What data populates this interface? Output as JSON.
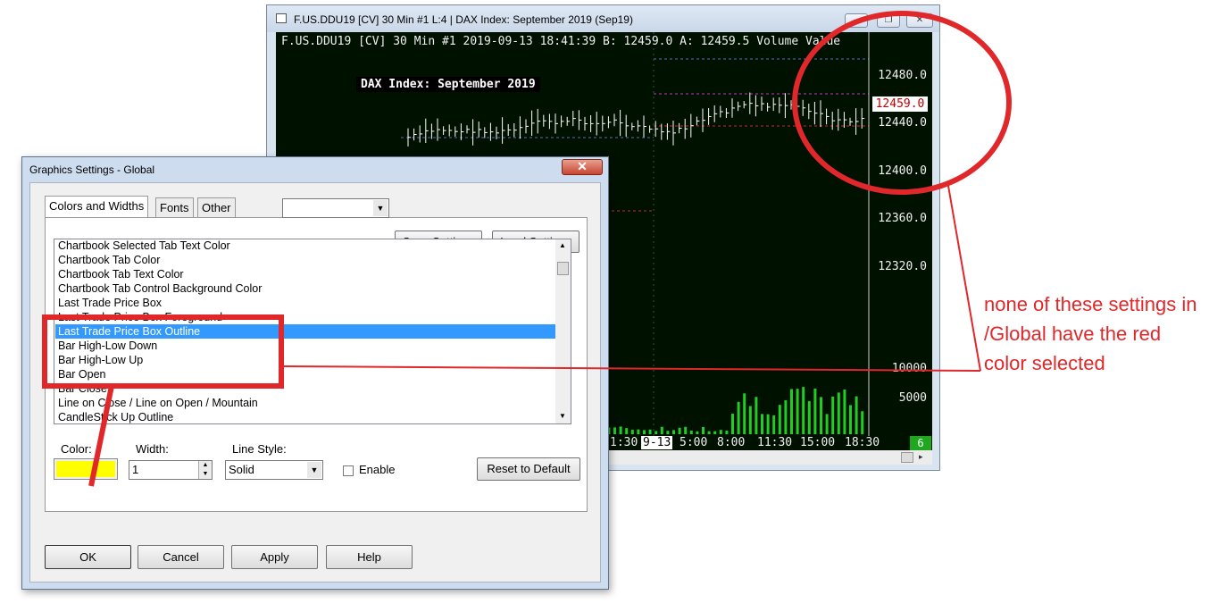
{
  "chart_window": {
    "title": "F.US.DDU19 [CV]  30 Min  #1  L:4 | DAX Index: September 2019 (Sep19)",
    "header": "F.US.DDU19 [CV]  30 Min  #1 2019-09-13 18:41:39 B: 12459.0 A: 12459.5 Volume Value",
    "symbol_title": "DAX Index: September 2019",
    "price_labels": [
      "12480.0",
      "12440.0",
      "12400.0",
      "12360.0",
      "12320.0"
    ],
    "last_price": "12459.0",
    "volume_labels": [
      "10000",
      "5000"
    ],
    "time_labels": [
      "1:30",
      "9-13",
      "5:00",
      "8:00",
      "11:30",
      "15:00",
      "18:30"
    ],
    "count_badge": "6"
  },
  "dialog": {
    "title": "Graphics Settings - Global",
    "close_label": "✕",
    "tabs": [
      {
        "label": "Colors and Widths",
        "active": true
      },
      {
        "label": "Fonts",
        "active": false
      },
      {
        "label": "Other",
        "active": false
      }
    ],
    "preset_value": "",
    "save_settings_label": "Save Settings",
    "load_settings_label": "Load Settings",
    "color_items": [
      "Chartbook Selected Tab Text Color",
      "Chartbook Tab Color",
      "Chartbook Tab Text Color",
      "Chartbook Tab Control Background Color",
      "Last Trade Price Box",
      "Last Trade Price Box Foreground",
      "Last Trade Price Box Outline",
      "Bar High-Low Down",
      "Bar High-Low Up",
      "Bar Open",
      "Bar Close",
      "Line on Close / Line on Open / Mountain",
      "CandleStick Up Outline"
    ],
    "selected_item": "Last Trade Price Box Outline",
    "color_label": "Color:",
    "color_value": "#ffff00",
    "width_label": "Width:",
    "width_value": "1",
    "line_style_label": "Line Style:",
    "line_style_value": "Solid",
    "enable_label": "Enable",
    "enable_checked": false,
    "reset_label": "Reset to Default",
    "ok_label": "OK",
    "cancel_label": "Cancel",
    "apply_label": "Apply",
    "help_label": "Help"
  },
  "annotation": {
    "text": "none of these settings in /Global have the red color selected",
    "color": "#e0272a"
  }
}
